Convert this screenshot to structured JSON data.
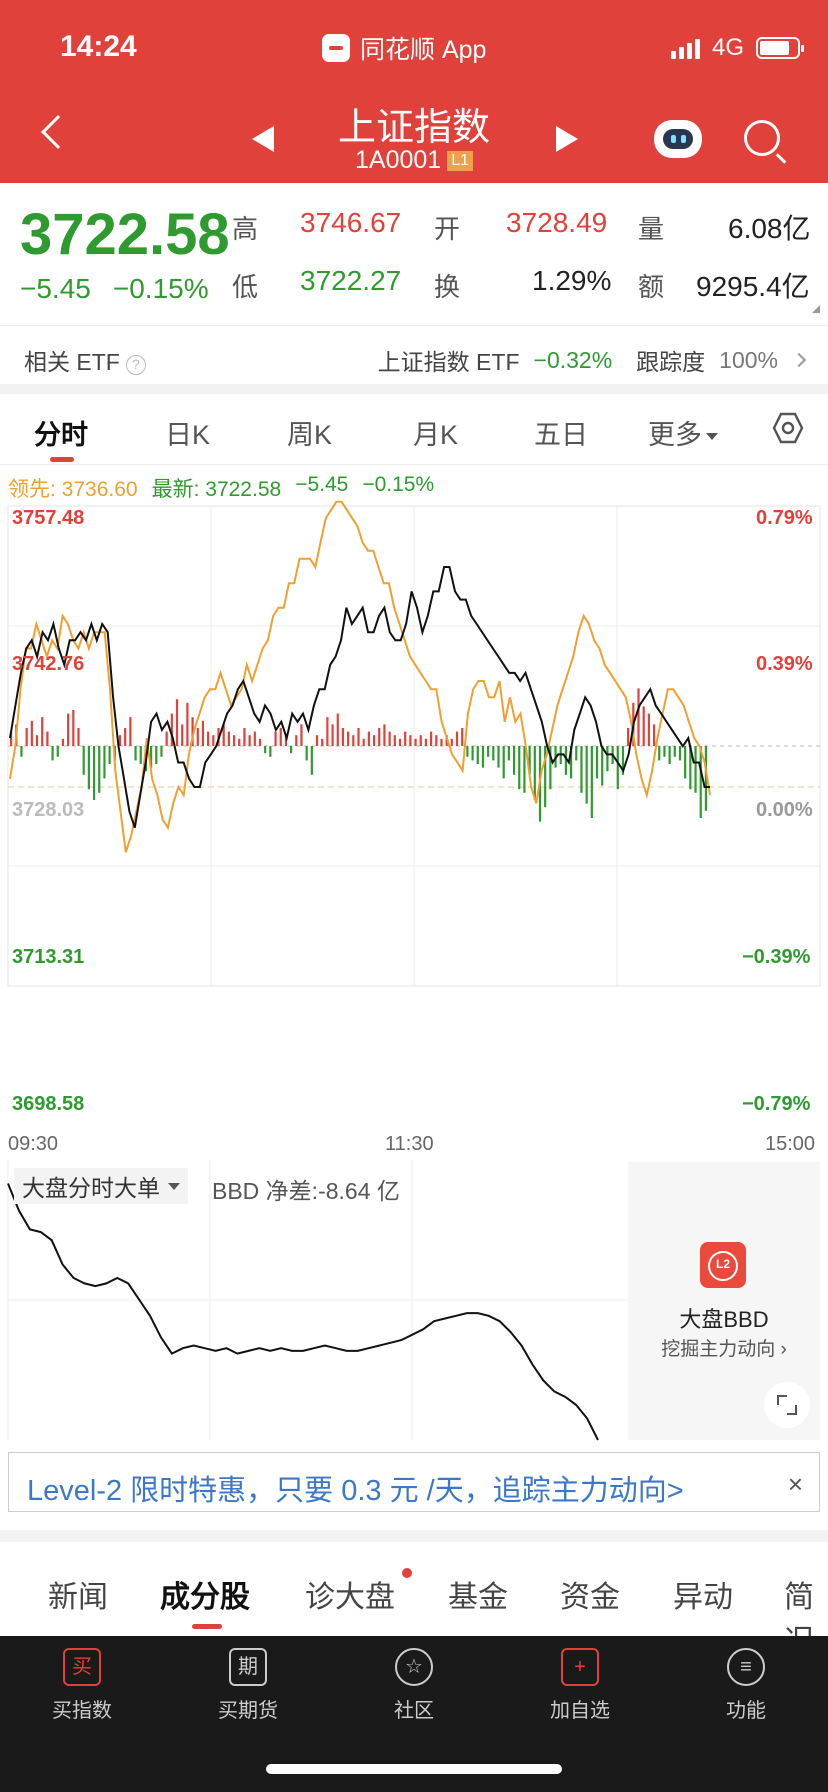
{
  "status_bar": {
    "time": "14:24",
    "app_name": "同花顺 App",
    "network": "4G",
    "battery_level": 0.8
  },
  "header": {
    "title": "上证指数",
    "code": "1A0001",
    "level_badge": "L1"
  },
  "quote": {
    "price": "3722.58",
    "change": "−5.45",
    "change_pct": "−0.15%",
    "labels": {
      "high": "高",
      "low": "低",
      "open": "开",
      "turnover": "换",
      "volume": "量",
      "amount": "额"
    },
    "high": "3746.67",
    "low": "3722.27",
    "open": "3728.49",
    "turnover_rate": "1.29%",
    "volume": "6.08亿",
    "amount": "9295.4亿"
  },
  "etf": {
    "label": "相关 ETF",
    "help": "?",
    "name": "上证指数 ETF",
    "change": "−0.32%",
    "tracking_label": "跟踪度",
    "tracking_value": "100%"
  },
  "chart_tabs": [
    "分时",
    "日K",
    "周K",
    "月K",
    "五日",
    "更多"
  ],
  "lead_info": {
    "lead": "领先: 3736.60",
    "latest": "最新: 3722.58",
    "change": "−5.45",
    "change_pct": "−0.15%"
  },
  "colors": {
    "header_red": "#e0413a",
    "up_red": "#e0413a",
    "down_green": "#2f9a2f",
    "lead_orange": "#f0a030",
    "link_blue": "#3c78c8"
  },
  "chart_data": {
    "type": "line",
    "y_left_labels": [
      "3757.48",
      "3742.76",
      "3728.03",
      "3713.31",
      "3698.58"
    ],
    "y_right_labels": [
      "0.79%",
      "0.39%",
      "0.00%",
      "−0.39%",
      "−0.79%"
    ],
    "x_labels": [
      "09:30",
      "11:30",
      "15:00"
    ],
    "ylim": [
      3698.58,
      3757.48
    ],
    "prev_close": 3728.03,
    "series": [
      {
        "values": [
          3729,
          3733,
          3737,
          3740,
          3741,
          3739,
          3742,
          3741,
          3743,
          3740,
          3738,
          3741,
          3741,
          3742,
          3741,
          3743,
          3741,
          3743,
          3742,
          3734,
          3728,
          3724,
          3720,
          3718,
          3722,
          3726,
          3731,
          3732,
          3730,
          3731,
          3729,
          3726,
          3726,
          3724,
          3723,
          3723,
          3726,
          3727,
          3728,
          3730,
          3732,
          3733,
          3735,
          3736,
          3734,
          3732,
          3731,
          3733,
          3732,
          3730,
          3731,
          3729,
          3732,
          3731,
          3732,
          3730,
          3733,
          3735,
          3735,
          3738,
          3739,
          3741,
          3745,
          3743,
          3744,
          3745,
          3742,
          3742,
          3744,
          3745,
          3742,
          3741,
          3741,
          3743,
          3747,
          3745,
          3742,
          3744,
          3747,
          3747,
          3750,
          3750,
          3747,
          3746,
          3746,
          3744,
          3743,
          3742,
          3741,
          3740,
          3739,
          3738,
          3737,
          3737,
          3736,
          3737,
          3735,
          3733,
          3731,
          3728,
          3726,
          3727,
          3727,
          3726,
          3730,
          3732,
          3734,
          3733,
          3731,
          3728,
          3727,
          3727,
          3726,
          3725,
          3727,
          3731,
          3733,
          3734,
          3735,
          3733,
          3732,
          3731,
          3730,
          3729,
          3728,
          3729,
          3726,
          3726,
          3723,
          3723
        ]
      },
      {
        "values": [
          3724,
          3728,
          3735,
          3740,
          3740,
          3743,
          3741,
          3739,
          3741,
          3740,
          3744,
          3743,
          3741,
          3740,
          3742,
          3740,
          3742,
          3742,
          3742,
          3735,
          3725,
          3720,
          3715,
          3717,
          3720,
          3723,
          3729,
          3724,
          3722,
          3719,
          3718,
          3721,
          3723,
          3722,
          3727,
          3730,
          3732,
          3734,
          3735,
          3735,
          3737,
          3735,
          3733,
          3734,
          3735,
          3738,
          3736,
          3738,
          3740,
          3741,
          3744,
          3745,
          3745,
          3748,
          3748,
          3751,
          3751,
          3751,
          3750,
          3753,
          3756,
          3757,
          3758,
          3758,
          3757,
          3756,
          3755,
          3753,
          3752,
          3752,
          3750,
          3748,
          3748,
          3745,
          3743,
          3741,
          3739,
          3738,
          3737,
          3736,
          3735,
          3735,
          3731,
          3729,
          3727,
          3726,
          3725,
          3732,
          3735,
          3736,
          3736,
          3734,
          3734,
          3736,
          3731,
          3734,
          3731,
          3732,
          3728,
          3723,
          3721,
          3725,
          3727,
          3730,
          3733,
          3735,
          3737,
          3739,
          3742,
          3744,
          3743,
          3741,
          3740,
          3738,
          3737,
          3736,
          3735,
          3734,
          3731,
          3727,
          3724,
          3722,
          3725,
          3729,
          3732,
          3735,
          3735,
          3734,
          3733,
          3731,
          3729,
          3728,
          3726,
          3722
        ]
      }
    ],
    "volume_bars": [
      0.4,
      0.6,
      -0.3,
      0.5,
      0.7,
      0.3,
      0.8,
      0.4,
      -0.4,
      -0.3,
      0.2,
      0.9,
      1.0,
      0.5,
      -0.8,
      -1.2,
      -1.5,
      -1.3,
      -0.9,
      -0.5,
      -0.4,
      0.3,
      0.5,
      0.8,
      -0.4,
      -0.5,
      -0.7,
      -0.6,
      -0.5,
      -0.3,
      0.4,
      0.9,
      1.3,
      0.6,
      1.2,
      0.8,
      0.5,
      0.7,
      0.4,
      0.3,
      0.5,
      0.6,
      0.4,
      0.3,
      0.2,
      0.5,
      0.3,
      0.4,
      0.2,
      -0.2,
      -0.3,
      0.4,
      0.5,
      0.3,
      -0.2,
      0.3,
      0.6,
      -0.4,
      -0.8,
      0.3,
      0.2,
      0.8,
      0.6,
      0.9,
      0.5,
      0.4,
      0.3,
      0.5,
      0.2,
      0.4,
      0.3,
      0.5,
      0.6,
      0.4,
      0.3,
      0.2,
      0.4,
      0.3,
      0.2,
      0.3,
      0.2,
      0.4,
      0.3,
      0.2,
      0.3,
      0.2,
      0.4,
      0.5,
      -0.3,
      -0.4,
      -0.5,
      -0.6,
      -0.3,
      -0.4,
      -0.6,
      -0.9,
      -0.4,
      -0.8,
      -1.2,
      -1.3,
      -0.8,
      -1.5,
      -2.1,
      -1.7,
      -1.2,
      -0.6,
      -0.5,
      -0.8,
      -0.9,
      -0.4,
      -1.3,
      -1.6,
      -2.0,
      -0.9,
      -1.1,
      -0.7,
      -0.5,
      -1.2,
      -0.8,
      0.5,
      1.2,
      1.6,
      1.1,
      0.9,
      0.6,
      -0.4,
      -0.3,
      -0.5,
      -0.3,
      -0.4,
      -0.9,
      -1.2,
      -1.3,
      -2.0,
      -1.8
    ]
  },
  "bbd": {
    "selector": "大盘分时大单",
    "net": "BBD 净差:-8.64 亿",
    "promo_title": "大盘BBD",
    "promo_sub": "挖掘主力动向",
    "chart_data": {
      "type": "line",
      "values": [
        0.95,
        0.85,
        0.78,
        0.77,
        0.74,
        0.65,
        0.6,
        0.58,
        0.57,
        0.58,
        0.6,
        0.58,
        0.52,
        0.46,
        0.38,
        0.32,
        0.34,
        0.35,
        0.34,
        0.33,
        0.34,
        0.32,
        0.33,
        0.34,
        0.33,
        0.34,
        0.33,
        0.33,
        0.34,
        0.35,
        0.34,
        0.33,
        0.33,
        0.34,
        0.35,
        0.36,
        0.37,
        0.39,
        0.41,
        0.44,
        0.45,
        0.46,
        0.47,
        0.47,
        0.46,
        0.44,
        0.4,
        0.35,
        0.28,
        0.22,
        0.18,
        0.16,
        0.13,
        0.08,
        0.0
      ]
    }
  },
  "promo_banner": {
    "text": "Level-2 限时特惠，只要 0.3 元 /天，追踪主力动向>",
    "close": "×"
  },
  "bottom_tabs": [
    "新闻",
    "成分股",
    "诊大盘",
    "基金",
    "资金",
    "异动",
    "简况"
  ],
  "tab_bar": [
    {
      "icon_text": "买",
      "label": "买指数"
    },
    {
      "icon_text": "期",
      "label": "买期货"
    },
    {
      "icon_text": "☆",
      "label": "社区"
    },
    {
      "icon_text": "+",
      "label": "加自选"
    },
    {
      "icon_text": "≡",
      "label": "功能"
    }
  ]
}
